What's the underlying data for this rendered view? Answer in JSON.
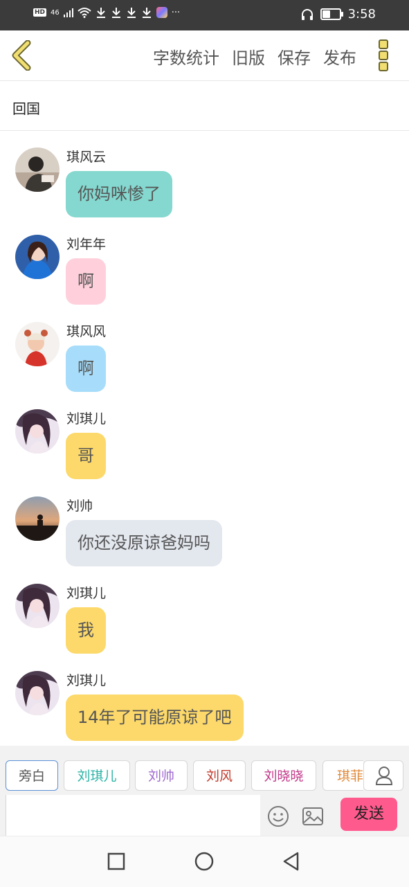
{
  "status_bar": {
    "hd": "HD",
    "network": "46",
    "more": "···",
    "time": "3:58",
    "battery_level": 0.5
  },
  "toolbar": {
    "actions": [
      "字数统计",
      "旧版",
      "保存",
      "发布"
    ],
    "accent": "#f1df72"
  },
  "title": "回国",
  "messages": [
    {
      "name": "琪风云",
      "text": "你妈咪惨了",
      "bubble_color": "#84d8cf",
      "avatar": "person-dark"
    },
    {
      "name": "刘年年",
      "text": "啊",
      "bubble_color": "#ffd0dc",
      "avatar": "girl-blue"
    },
    {
      "name": "琪风风",
      "text": "啊",
      "bubble_color": "#a7ddfa",
      "avatar": "baby"
    },
    {
      "name": "刘琪儿",
      "text": "哥",
      "bubble_color": "#fcd96a",
      "avatar": "girl-purple"
    },
    {
      "name": "刘帅",
      "text": "你还没原谅爸妈吗",
      "bubble_color": "#e3e7ee",
      "avatar": "sunset"
    },
    {
      "name": "刘琪儿",
      "text": "我",
      "bubble_color": "#fcd96a",
      "avatar": "girl-purple"
    },
    {
      "name": "刘琪儿",
      "text": "14年了可能原谅了吧",
      "bubble_color": "#fcd96a",
      "avatar": "girl-purple"
    }
  ],
  "roles": [
    {
      "label": "旁白",
      "color": "#555555",
      "active": true
    },
    {
      "label": "刘琪儿",
      "color": "#2bb3a6",
      "active": false
    },
    {
      "label": "刘帅",
      "color": "#a06ad0",
      "active": false
    },
    {
      "label": "刘风",
      "color": "#c0392b",
      "active": false
    },
    {
      "label": "刘晓晓",
      "color": "#c2398a",
      "active": false
    },
    {
      "label": "琪菲",
      "color": "#e08a3a",
      "active": false
    }
  ],
  "composer": {
    "input_value": "",
    "send_label": "发送",
    "send_color": "#ff5a8e"
  }
}
